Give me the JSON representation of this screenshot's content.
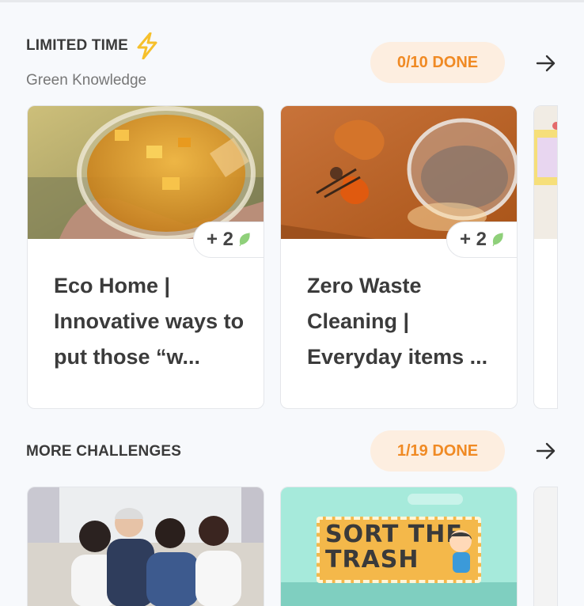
{
  "limited": {
    "title": "LIMITED TIME",
    "subtitle": "Green Knowledge",
    "progress": "0/10 DONE",
    "cards": [
      {
        "title": "Eco Home | Innovative ways to put those “w...",
        "points": "+ 2"
      },
      {
        "title": "Zero Waste Cleaning | Everyday items ...",
        "points": "+ 2"
      }
    ]
  },
  "more": {
    "title": "MORE CHALLENGES",
    "progress": "1/19 DONE",
    "cards": [
      {
        "image": "family-photo"
      },
      {
        "logo_line1": "SORT THE",
        "logo_line2": "TRASH"
      }
    ]
  },
  "icons": {
    "bolt": "lightning-bolt-icon",
    "arrow": "arrow-right-icon",
    "leaf": "leaf-icon"
  },
  "colors": {
    "accent": "#f08a24",
    "pill_bg": "#fdeee0",
    "bolt": "#f6c02b",
    "leaf": "#8fd07a"
  }
}
